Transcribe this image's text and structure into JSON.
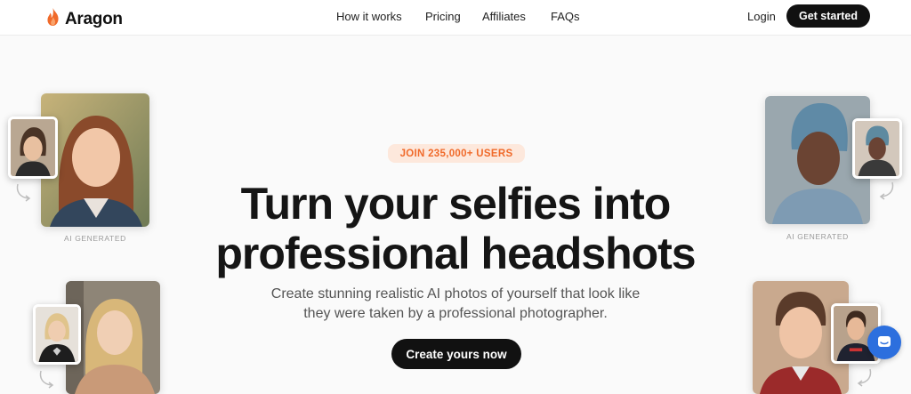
{
  "nav": {
    "brand": "Aragon",
    "links": [
      "How it works",
      "Pricing",
      "Affiliates",
      "FAQs"
    ],
    "login": "Login",
    "get_started": "Get started"
  },
  "hero": {
    "badge": "JOIN 235,000+ USERS",
    "headline_line1": "Turn your selfies into",
    "headline_line2": "professional headshots",
    "subtitle_line1": "Create stunning realistic AI photos of yourself that look like",
    "subtitle_line2": "they were taken by a professional photographer.",
    "cta": "Create yours now"
  },
  "labels": {
    "ai_generated": "AI GENERATED"
  },
  "colors": {
    "accent": "#f06a2a",
    "badge_bg": "#fde8dc",
    "dark": "#111111",
    "chat": "#2c6fde"
  },
  "icons": {
    "logo": "flame-icon",
    "chat": "chat-icon",
    "arrows": "curved-arrow-icon"
  }
}
